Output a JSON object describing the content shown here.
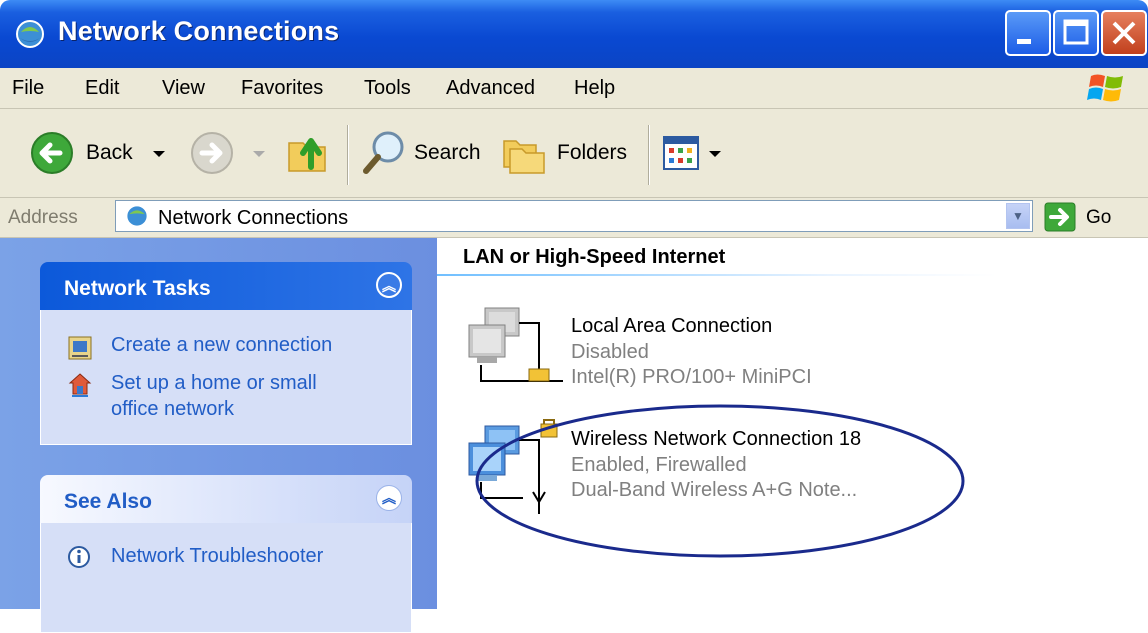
{
  "window": {
    "title": "Network Connections"
  },
  "menu": {
    "items": [
      "File",
      "Edit",
      "View",
      "Favorites",
      "Tools",
      "Advanced",
      "Help"
    ]
  },
  "toolbar": {
    "back_label": "Back",
    "search_label": "Search",
    "folders_label": "Folders"
  },
  "address": {
    "label": "Address",
    "value": "Network Connections",
    "go_label": "Go"
  },
  "tasks_panel": {
    "title": "Network Tasks",
    "items": [
      {
        "label": "Create a new connection",
        "icon": "new-connection-icon"
      },
      {
        "label_line1": "Set up a home or small",
        "label_line2": "office network",
        "icon": "home-network-icon"
      }
    ]
  },
  "see_also_panel": {
    "title": "See Also",
    "items": [
      {
        "label": "Network Troubleshooter",
        "icon": "info-icon"
      }
    ]
  },
  "content": {
    "section_title": "LAN or High-Speed Internet",
    "connections": [
      {
        "name": "Local Area Connection",
        "status": "Disabled",
        "device": "Intel(R) PRO/100+ MiniPCI"
      },
      {
        "name": "Wireless Network Connection 18",
        "status": "Enabled, Firewalled",
        "device": "Dual-Band Wireless A+G Note..."
      }
    ]
  },
  "colors": {
    "titlebar": "#0a49d2",
    "link": "#215dc6",
    "ellipse": "#1a2a8c",
    "chrome": "#ece9d8"
  }
}
